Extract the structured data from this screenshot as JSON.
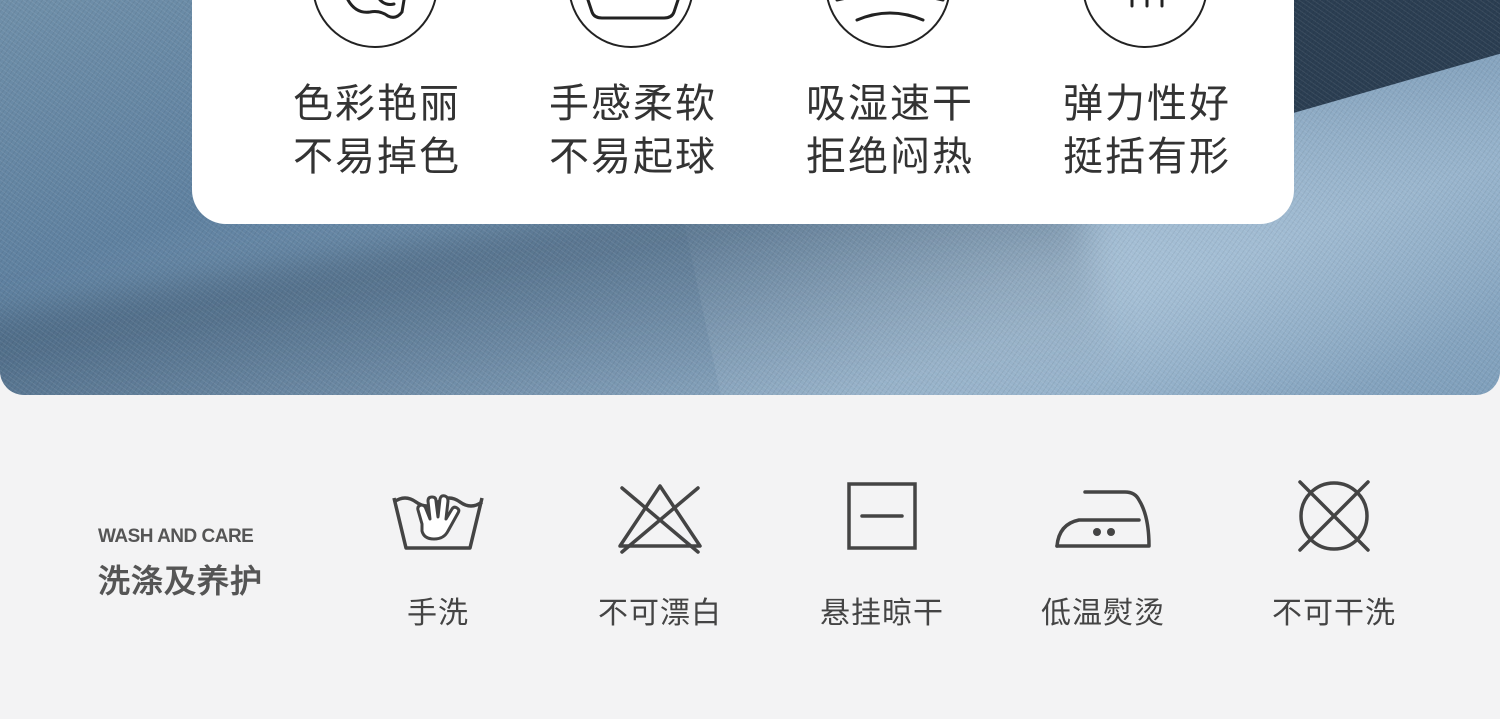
{
  "features": [
    {
      "line1": "色彩艳丽",
      "line2": "不易掉色",
      "icon": "colorfast-icon"
    },
    {
      "line1": "手感柔软",
      "line2": "不易起球",
      "icon": "soft-touch-icon"
    },
    {
      "line1": "吸湿速干",
      "line2": "拒绝闷热",
      "icon": "quick-dry-icon"
    },
    {
      "line1": "弹力性好",
      "line2": "挺括有形",
      "icon": "elastic-icon"
    }
  ],
  "care": {
    "title_en": "WASH AND CARE",
    "title_zh": "洗涤及养护",
    "items": [
      {
        "label": "手洗",
        "icon": "hand-wash-icon"
      },
      {
        "label": "不可漂白",
        "icon": "no-bleach-icon"
      },
      {
        "label": "悬挂晾干",
        "icon": "line-dry-icon"
      },
      {
        "label": "低温熨烫",
        "icon": "low-iron-icon"
      },
      {
        "label": "不可干洗",
        "icon": "no-dry-clean-icon"
      }
    ]
  },
  "colors": {
    "fabric": "#6f8fa9",
    "card": "#ffffff",
    "care_background": "#f3f3f4",
    "text": "#333333"
  }
}
